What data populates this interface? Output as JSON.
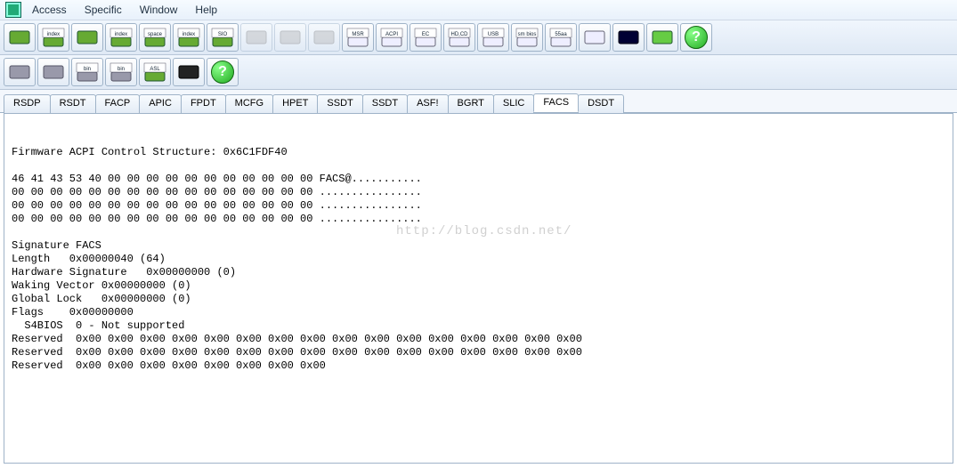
{
  "menu": {
    "items": [
      "Access",
      "Specific",
      "Window",
      "Help"
    ]
  },
  "toolbar_main": {
    "icons": [
      "chip1-icon",
      "chip-index-icon",
      "chip2-icon",
      "chip-index2-icon",
      "space-icon",
      "wave-index-icon",
      "sio-icon",
      "gray1-icon",
      "gray2-icon",
      "gray3-icon",
      "msr-icon",
      "acpi-icon",
      "ec-icon",
      "hdcd-icon",
      "usb-icon",
      "smbios-icon",
      "55aa-icon",
      "monitor-icon",
      "terminal-icon",
      "chip-green-icon",
      "help-icon"
    ],
    "labels": [
      "",
      "index",
      "",
      "index",
      "space",
      "index",
      "SIO",
      "",
      "",
      "",
      "MSR",
      "ACPI",
      "EC",
      "HD,CD",
      "USB",
      "sm bios",
      "55aa",
      "",
      "",
      "",
      ""
    ]
  },
  "toolbar_sub": {
    "icons": [
      "save-icon",
      "save-multi-icon",
      "save-bin-icon",
      "save-bin-multi-icon",
      "asl-icon",
      "binoculars-icon",
      "help-icon"
    ],
    "labels": [
      "",
      "",
      "bin",
      "bin",
      "ASL",
      "",
      ""
    ]
  },
  "tabs": [
    "RSDP",
    "RSDT",
    "FACP",
    "APIC",
    "FPDT",
    "MCFG",
    "HPET",
    "SSDT",
    "SSDT",
    "ASF!",
    "BGRT",
    "SLIC",
    "FACS",
    "DSDT"
  ],
  "active_tab_index": 12,
  "content_lines": [
    "Firmware ACPI Control Structure: 0x6C1FDF40",
    "",
    "46 41 43 53 40 00 00 00 00 00 00 00 00 00 00 00 FACS@...........",
    "00 00 00 00 00 00 00 00 00 00 00 00 00 00 00 00 ................",
    "00 00 00 00 00 00 00 00 00 00 00 00 00 00 00 00 ................",
    "00 00 00 00 00 00 00 00 00 00 00 00 00 00 00 00 ................",
    "",
    "Signature FACS",
    "Length   0x00000040 (64)",
    "Hardware Signature   0x00000000 (0)",
    "Waking Vector 0x00000000 (0)",
    "Global Lock   0x00000000 (0)",
    "Flags    0x00000000",
    "  S4BIOS  0 - Not supported",
    "Reserved  0x00 0x00 0x00 0x00 0x00 0x00 0x00 0x00 0x00 0x00 0x00 0x00 0x00 0x00 0x00 0x00",
    "Reserved  0x00 0x00 0x00 0x00 0x00 0x00 0x00 0x00 0x00 0x00 0x00 0x00 0x00 0x00 0x00 0x00",
    "Reserved  0x00 0x00 0x00 0x00 0x00 0x00 0x00 0x00"
  ],
  "watermark": "http://blog.csdn.net/"
}
